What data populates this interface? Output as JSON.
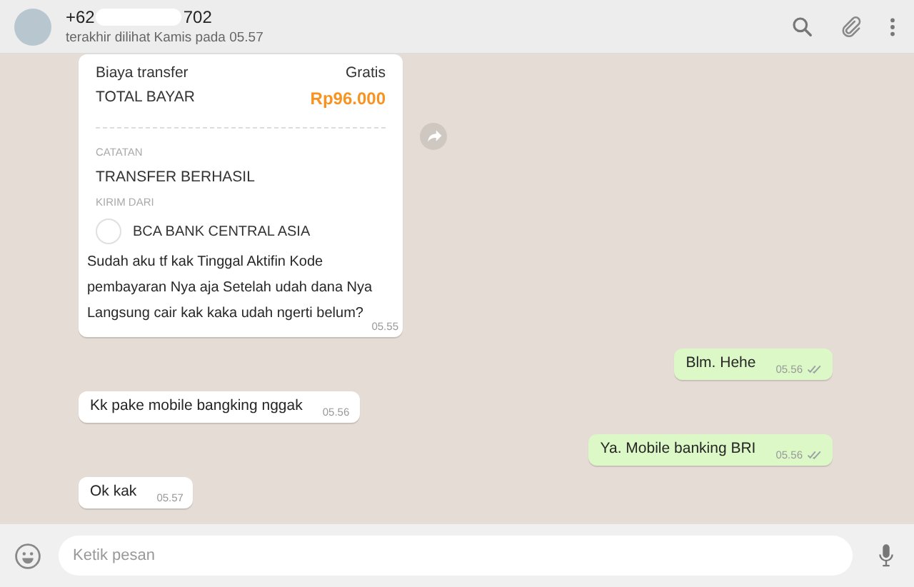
{
  "header": {
    "contact_prefix": "+62",
    "contact_suffix": "702",
    "last_seen": "terakhir dilihat Kamis pada 05.57"
  },
  "messages": [
    {
      "kind": "incoming_image",
      "receipt": {
        "rows": [
          {
            "label": "Biaya transfer",
            "value": "Gratis",
            "kind": "plain"
          },
          {
            "label": "TOTAL BAYAR",
            "value": "Rp96.000",
            "kind": "total"
          }
        ],
        "note_label": "CATATAN",
        "note": "TRANSFER BERHASIL",
        "sender_label": "KIRIM DARI",
        "sender": "BCA BANK CENTRAL ASIA"
      },
      "text": "Sudah aku tf kak Tinggal Aktifin Kode pembayaran Nya aja Setelah udah dana Nya Langsung cair kak kaka udah ngerti belum?",
      "time": "05.55"
    },
    {
      "kind": "outgoing",
      "text": "Blm. Hehe",
      "time": "05.56",
      "read": false
    },
    {
      "kind": "incoming",
      "text": "Kk pake mobile bangking nggak",
      "time": "05.56"
    },
    {
      "kind": "outgoing",
      "text": "Ya. Mobile banking BRI",
      "time": "05.56",
      "read": false
    },
    {
      "kind": "incoming",
      "text": "Ok kak",
      "time": "05.57"
    }
  ],
  "composer": {
    "placeholder": "Ketik pesan"
  }
}
